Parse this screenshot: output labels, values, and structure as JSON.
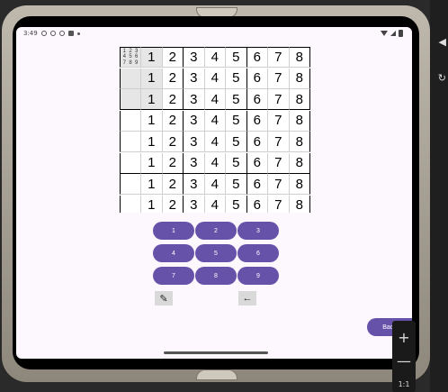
{
  "status_bar": {
    "time": "3:49",
    "icons_left": [
      "clock-icon",
      "shield-icon",
      "download-icon",
      "a-icon",
      "dot-icon"
    ],
    "icons_right": [
      "wifi-icon",
      "cell-signal-icon",
      "battery-icon"
    ]
  },
  "grid": {
    "notes": [
      "1",
      "2",
      "3",
      "4",
      "5",
      "6",
      "7",
      "8",
      "9"
    ],
    "rows": [
      [
        "1",
        "2",
        "3",
        "4",
        "5",
        "6",
        "7",
        "8"
      ],
      [
        "1",
        "2",
        "3",
        "4",
        "5",
        "6",
        "7",
        "8"
      ],
      [
        "1",
        "2",
        "3",
        "4",
        "5",
        "6",
        "7",
        "8"
      ],
      [
        "1",
        "2",
        "3",
        "4",
        "5",
        "6",
        "7",
        "8"
      ],
      [
        "1",
        "2",
        "3",
        "4",
        "5",
        "6",
        "7",
        "8"
      ],
      [
        "1",
        "2",
        "3",
        "4",
        "5",
        "6",
        "7",
        "8"
      ],
      [
        "1",
        "2",
        "3",
        "4",
        "5",
        "6",
        "7",
        "8"
      ],
      [
        "1",
        "2",
        "3",
        "4",
        "5",
        "6",
        "7",
        "8"
      ]
    ]
  },
  "numpad": {
    "keys": [
      "1",
      "2",
      "3",
      "4",
      "5",
      "6",
      "7",
      "8",
      "9"
    ]
  },
  "tools": {
    "pencil_icon": "pencil-icon",
    "backspace_label": "←"
  },
  "back_button": {
    "label": "Back"
  },
  "emulator": {
    "zoom_in": "+",
    "zoom_out": "—",
    "zoom_level": "1:1"
  }
}
